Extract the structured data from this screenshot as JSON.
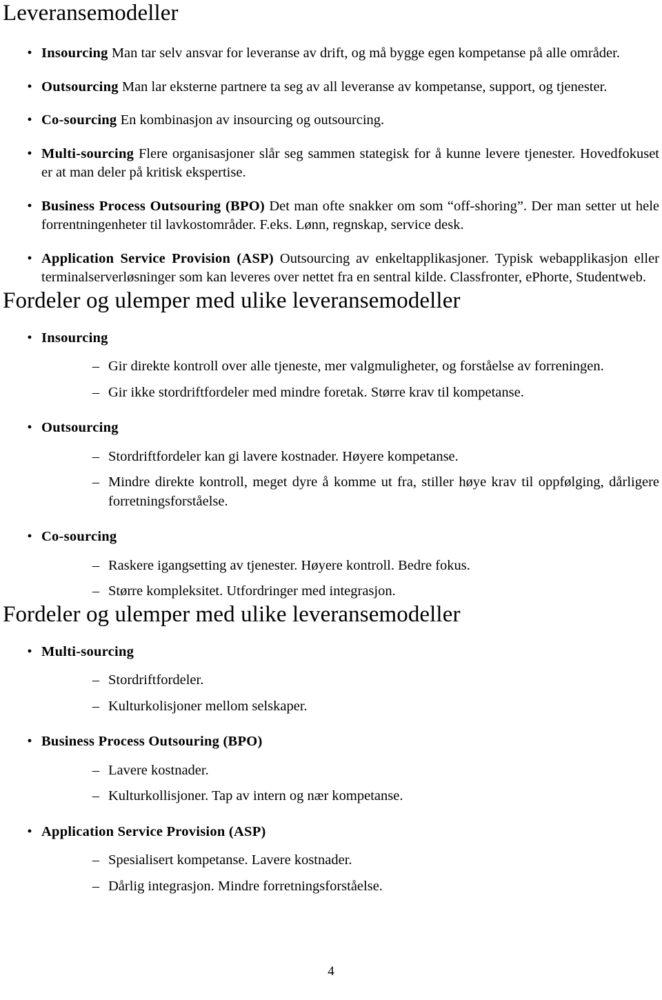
{
  "document": {
    "language": "Norwegian",
    "page_number": "4"
  },
  "sections": [
    {
      "id": "leveransemodeller",
      "title": "Leveransemodeller",
      "items": [
        {
          "term": "Insourcing",
          "description": "Man tar selv ansvar for leveranse av drift, og må bygge egen kompetanse på alle områder."
        },
        {
          "term": "Outsourcing",
          "description": "Man lar eksterne partnere ta seg av all leveranse av kompetanse, support, og tjenester."
        },
        {
          "term": "Co-sourcing",
          "description": "En kombinasjon av insourcing og outsourcing."
        },
        {
          "term": "Multi-sourcing",
          "description": "Flere organisasjoner slår seg sammen stategisk for å kunne levere tjenester. Hovedfokuset er at man deler på kritisk ekspertise."
        },
        {
          "term": "Business Process Outsouring (BPO)",
          "description": "Det man ofte snakker om som “off-shoring”. Der man setter ut hele forrentningenheter til lavkostområder. F.eks. Lønn, regnskap, service desk."
        },
        {
          "term": "Application Service Provision (ASP)",
          "description": "Outsourcing av enkeltapplikasjoner. Typisk webapplikasjon eller terminalserverløsninger som kan leveres over nettet fra en sentral kilde. Classfronter, ePhorte, Studentweb."
        }
      ]
    },
    {
      "id": "fordeler-ulemper-1",
      "title": "Fordeler og ulemper med ulike leveransemodeller",
      "items": [
        {
          "term": "Insourcing",
          "subitems": [
            "Gir direkte kontroll over alle tjeneste, mer valgmuligheter, og forståelse av forreningen.",
            "Gir ikke stordriftfordeler med mindre foretak. Større krav til kompetanse."
          ]
        },
        {
          "term": "Outsourcing",
          "subitems": [
            "Stordriftfordeler kan gi lavere kostnader. Høyere kompetanse.",
            "Mindre direkte kontroll, meget dyre å komme ut fra, stiller høye krav til oppfølging, dårligere forretningsforståelse."
          ]
        },
        {
          "term": "Co-sourcing",
          "subitems": [
            "Raskere igangsetting av tjenester. Høyere kontroll. Bedre fokus.",
            "Større kompleksitet. Utfordringer med integrasjon."
          ]
        }
      ]
    },
    {
      "id": "fordeler-ulemper-2",
      "title": "Fordeler og ulemper med ulike leveransemodeller",
      "items": [
        {
          "term": "Multi-sourcing",
          "subitems": [
            "Stordriftfordeler.",
            "Kulturkolisjoner mellom selskaper."
          ]
        },
        {
          "term": "Business Process Outsouring (BPO)",
          "subitems": [
            "Lavere kostnader.",
            "Kulturkollisjoner. Tap av intern og nær kompetanse."
          ]
        },
        {
          "term": "Application Service Provision (ASP)",
          "subitems": [
            "Spesialisert kompetanse. Lavere kostnader.",
            "Dårlig integrasjon. Mindre forretningsforståelse."
          ]
        }
      ]
    }
  ],
  "glyphs": {
    "bullet": "•",
    "dash": "–"
  }
}
